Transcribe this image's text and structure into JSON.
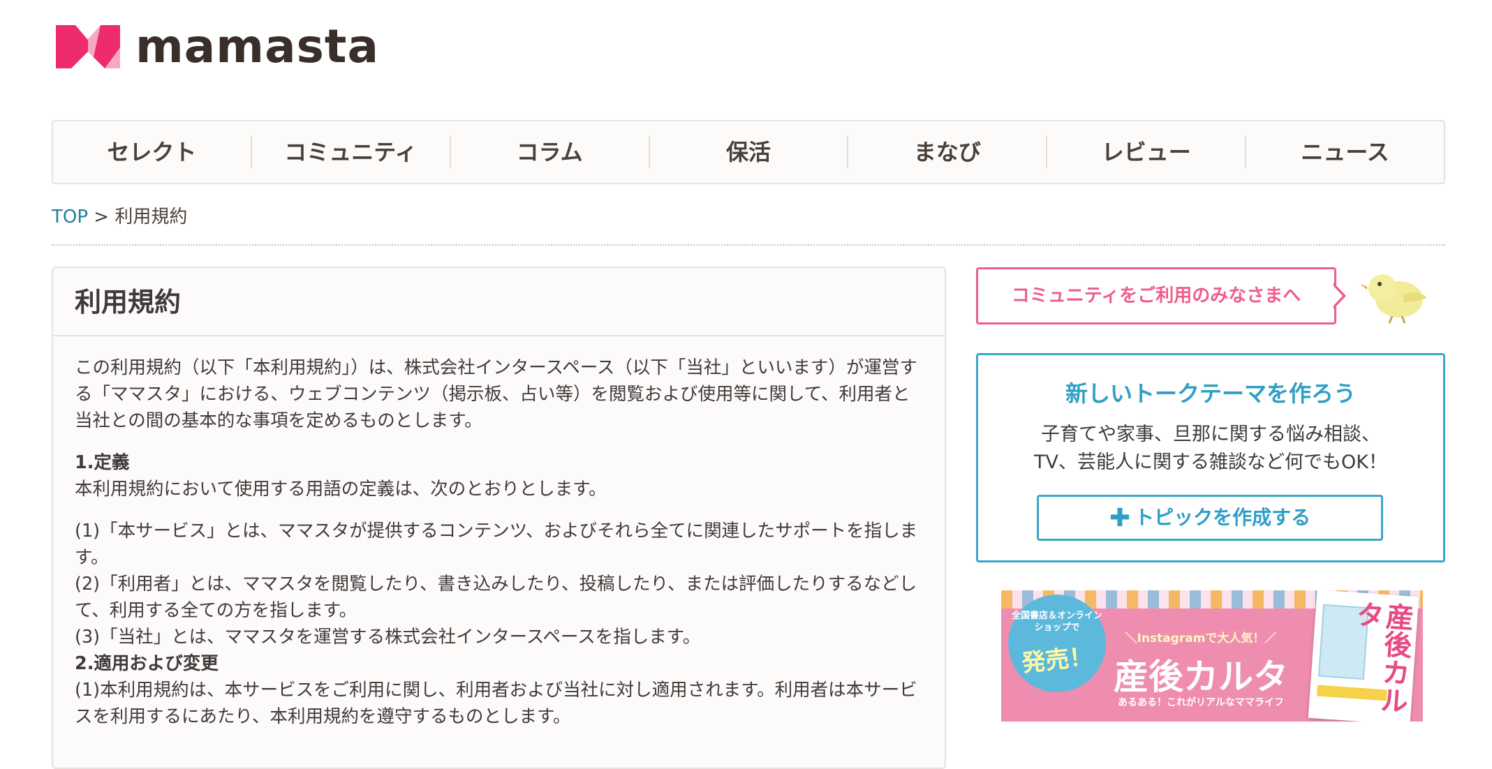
{
  "header": {
    "logo_text": "mamasta",
    "colors": {
      "logo_pink": "#ee2b6c",
      "logo_light": "#f7a8c0"
    }
  },
  "nav": {
    "items": [
      "セレクト",
      "コミュニティ",
      "コラム",
      "保活",
      "まなび",
      "レビュー",
      "ニュース"
    ]
  },
  "breadcrumb": {
    "home": "TOP",
    "separator": ">",
    "current": "利用規約"
  },
  "article": {
    "title": "利用規約",
    "intro": "この利用規約（以下「本利用規約」）は、株式会社インタースペース（以下「当社」といいます）が運営する「ママスタ」における、ウェブコンテンツ（掲示板、占い等）を閲覧および使用等に関して、利用者と当社との間の基本的な事項を定めるものとします。",
    "s1_title": "1.定義",
    "s1_text": "本利用規約において使用する用語の定義は、次のとおりとします。",
    "s1_item1": "(1)「本サービス」とは、ママスタが提供するコンテンツ、およびそれら全てに関連したサポートを指します。",
    "s1_item2": "(2)「利用者」とは、ママスタを閲覧したり、書き込みしたり、投稿したり、または評価したりするなどして、利用する全ての方を指します。",
    "s1_item3": "(3)「当社」とは、ママスタを運営する株式会社インタースペースを指します。",
    "s2_title": "2.適用および変更",
    "s2_item1": "(1)本利用規約は、本サービスをご利用に関し、利用者および当社に対し適用されます。利用者は本サービスを利用するにあたり、本利用規約を遵守するものとします。"
  },
  "sidebar": {
    "notice_label": "コミュニティをご利用のみなさまへ",
    "talk": {
      "title": "新しいトークテーマを作ろう",
      "desc_line1": "子育てや家事、旦那に関する悩み相談、",
      "desc_line2": "TV、芸能人に関する雑談など何でもOK！",
      "button_icon": "plus-icon",
      "button_label": "トピックを作成する"
    },
    "banner": {
      "badge_small": "全国書店＆オンラインショップで",
      "badge_big": "発売！",
      "sub": "＼Instagramで大人気！／",
      "title": "産後カルタ",
      "tagline": "あるある！これがリアルなママライフ",
      "book_title": "産後カルタ"
    }
  },
  "colors": {
    "accent_pink": "#ee5e8a",
    "accent_blue": "#2f9fc5",
    "link_teal": "#1f7f9a",
    "text": "#3e3a39"
  }
}
